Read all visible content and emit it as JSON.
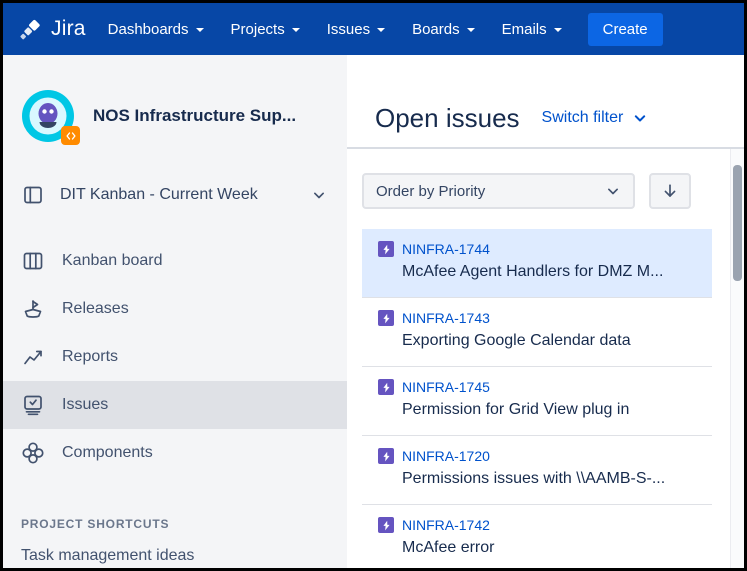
{
  "topnav": {
    "logo_label": "Jira",
    "items": [
      {
        "label": "Dashboards"
      },
      {
        "label": "Projects"
      },
      {
        "label": "Issues"
      },
      {
        "label": "Boards"
      },
      {
        "label": "Emails"
      }
    ],
    "create_label": "Create"
  },
  "sidebar": {
    "project_name": "NOS Infrastructure Sup...",
    "board_selector_label": "DIT Kanban - Current Week",
    "items": [
      {
        "label": "Kanban board",
        "icon": "kanban-board-icon",
        "active": false
      },
      {
        "label": "Releases",
        "icon": "ship-icon",
        "active": false
      },
      {
        "label": "Reports",
        "icon": "chart-icon",
        "active": false
      },
      {
        "label": "Issues",
        "icon": "issues-icon",
        "active": true
      },
      {
        "label": "Components",
        "icon": "components-icon",
        "active": false
      }
    ],
    "shortcuts_header": "PROJECT SHORTCUTS",
    "shortcut_link": "Task management ideas"
  },
  "main": {
    "title": "Open issues",
    "switch_filter_label": "Switch filter",
    "order_by_value": "Order by Priority",
    "issues": [
      {
        "key": "NINFRA-1744",
        "summary": "McAfee Agent Handlers for DMZ M...",
        "type": "bolt",
        "selected": true
      },
      {
        "key": "NINFRA-1743",
        "summary": "Exporting Google Calendar data",
        "type": "bolt",
        "selected": false
      },
      {
        "key": "NINFRA-1745",
        "summary": "Permission for Grid View plug in",
        "type": "bolt",
        "selected": false
      },
      {
        "key": "NINFRA-1720",
        "summary": "Permissions issues with \\\\AAMB-S-...",
        "type": "bolt",
        "selected": false
      },
      {
        "key": "NINFRA-1742",
        "summary": "McAfee error",
        "type": "bolt",
        "selected": false
      }
    ]
  },
  "colors": {
    "topnav-bg": "#0747A6",
    "create-bg": "#0C66E4",
    "sidebar-bg": "#F4F5F7",
    "sidebar-active-bg": "#DFE1E6",
    "link-blue": "#0052CC",
    "text-dark": "#172B4D",
    "text-mid": "#42526E",
    "selected-row-bg": "#DEEBFF",
    "issue-type-purple": "#6554C0",
    "border-gray": "#DFE1E6",
    "avatar-teal": "#00C7E5",
    "badge-orange": "#FF8B00"
  }
}
